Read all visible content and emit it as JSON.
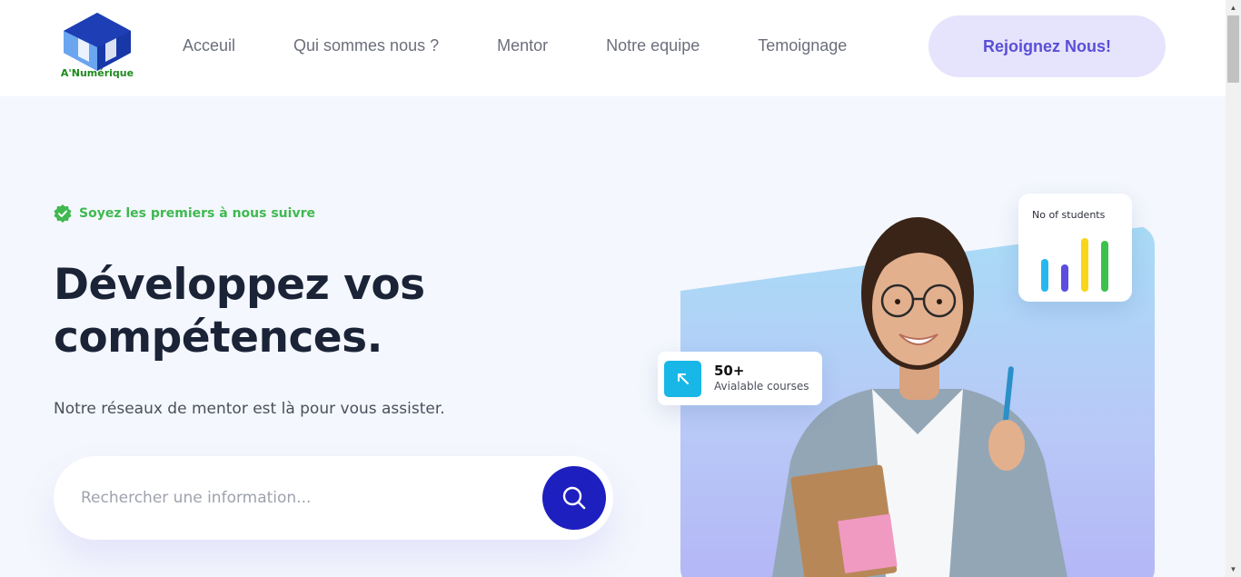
{
  "brand": {
    "logo_text": "A'Numérique"
  },
  "nav": {
    "items": [
      {
        "label": "Acceuil"
      },
      {
        "label": "Qui sommes nous ?"
      },
      {
        "label": "Mentor"
      },
      {
        "label": "Notre equipe"
      },
      {
        "label": "Temoignage"
      }
    ],
    "cta_label": "Rejoignez Nous!"
  },
  "hero": {
    "badge": "Soyez les premiers à nous suivre",
    "title_line1": "Développez vos",
    "title_line2": "compétences.",
    "subtitle": "Notre réseaux de mentor est là pour vous assister.",
    "search_placeholder": "Rechercher une information..."
  },
  "students_card": {
    "title": "No of students",
    "bars": [
      {
        "value": 0.55,
        "color": "#27b7ef"
      },
      {
        "value": 0.45,
        "color": "#5b4de0"
      },
      {
        "value": 0.9,
        "color": "#f9d51b"
      },
      {
        "value": 0.85,
        "color": "#3cc14b"
      }
    ]
  },
  "courses_card": {
    "count": "50+",
    "label": "Avialable courses"
  },
  "colors": {
    "accent": "#1d1fbf",
    "cta_bg": "#e6e3fd",
    "cta_text": "#5a4fd6",
    "badge_green": "#3fb950",
    "heading": "#1b2337"
  }
}
